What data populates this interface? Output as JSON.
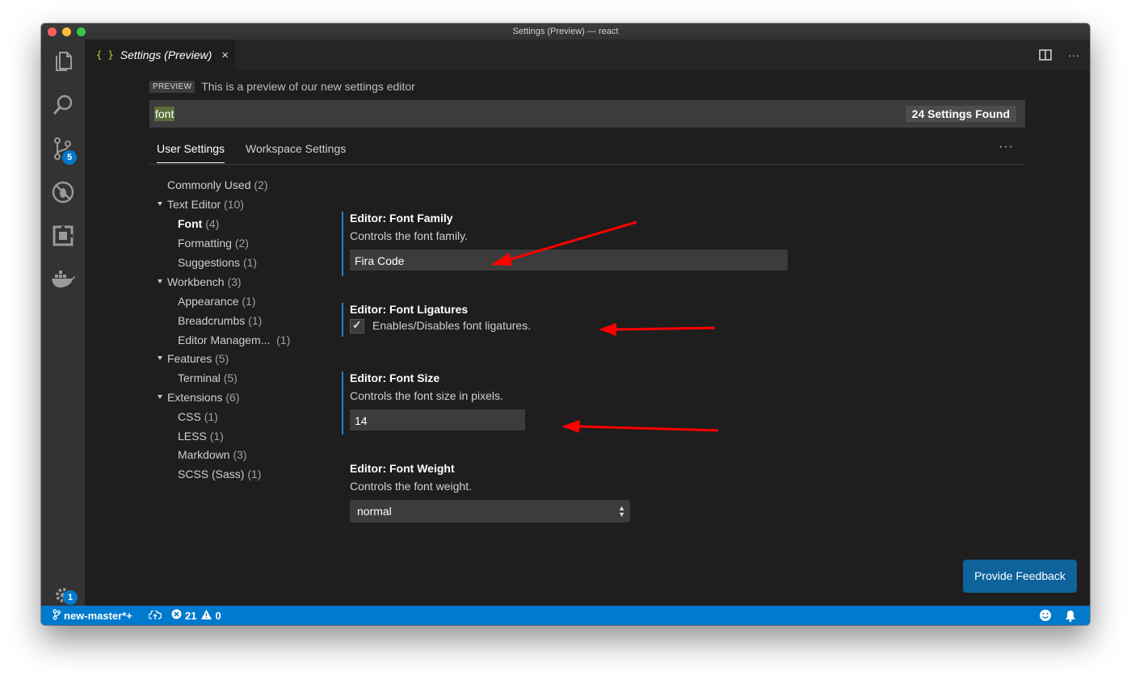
{
  "window": {
    "title": "Settings (Preview) — react"
  },
  "activity_bar": {
    "icons": [
      "files-icon",
      "search-icon",
      "source-control-icon",
      "debug-icon",
      "extensions-icon",
      "docker-icon",
      "gear-icon"
    ],
    "source_control_badge": "5",
    "settings_badge": "1"
  },
  "tab": {
    "icon": "{ }",
    "title": "Settings (Preview)",
    "close": "×"
  },
  "preview": {
    "tag": "PREVIEW",
    "text": "This is a preview of our new settings editor"
  },
  "search": {
    "value": "font",
    "count": "24 Settings Found"
  },
  "settings_tabs": {
    "user": "User Settings",
    "workspace": "Workspace Settings",
    "more": "···"
  },
  "toc": [
    {
      "label": "Commonly Used",
      "count": "(2)"
    },
    {
      "label": "Text Editor",
      "count": "(10)"
    },
    {
      "label": "Font",
      "count": "(4)"
    },
    {
      "label": "Formatting",
      "count": "(2)"
    },
    {
      "label": "Suggestions",
      "count": "(1)"
    },
    {
      "label": "Workbench",
      "count": "(3)"
    },
    {
      "label": "Appearance",
      "count": "(1)"
    },
    {
      "label": "Breadcrumbs",
      "count": "(1)"
    },
    {
      "label": "Editor Managem...",
      "count": "(1)"
    },
    {
      "label": "Features",
      "count": "(5)"
    },
    {
      "label": "Terminal",
      "count": "(5)"
    },
    {
      "label": "Extensions",
      "count": "(6)"
    },
    {
      "label": "CSS",
      "count": "(1)"
    },
    {
      "label": "LESS",
      "count": "(1)"
    },
    {
      "label": "Markdown",
      "count": "(3)"
    },
    {
      "label": "SCSS (Sass)",
      "count": "(1)"
    }
  ],
  "settings": {
    "font_family": {
      "category": "Editor:",
      "name": "Font Family",
      "description": "Controls the font family.",
      "value": "Fira Code"
    },
    "font_ligatures": {
      "category": "Editor:",
      "name": "Font Ligatures",
      "description": "Enables/Disables font ligatures.",
      "checked": true,
      "check_glyph": "✓"
    },
    "font_size": {
      "category": "Editor:",
      "name": "Font Size",
      "description": "Controls the font size in pixels.",
      "value": "14"
    },
    "font_weight": {
      "category": "Editor:",
      "name": "Font Weight",
      "description": "Controls the font weight.",
      "value": "normal"
    }
  },
  "feedback_button": "Provide Feedback",
  "status_bar": {
    "branch": "new-master*+",
    "errors": "21",
    "warnings": "0"
  },
  "colors": {
    "accent": "#007acc",
    "annotation_arrow": "#ff0000",
    "feedback": "#0e639c"
  }
}
